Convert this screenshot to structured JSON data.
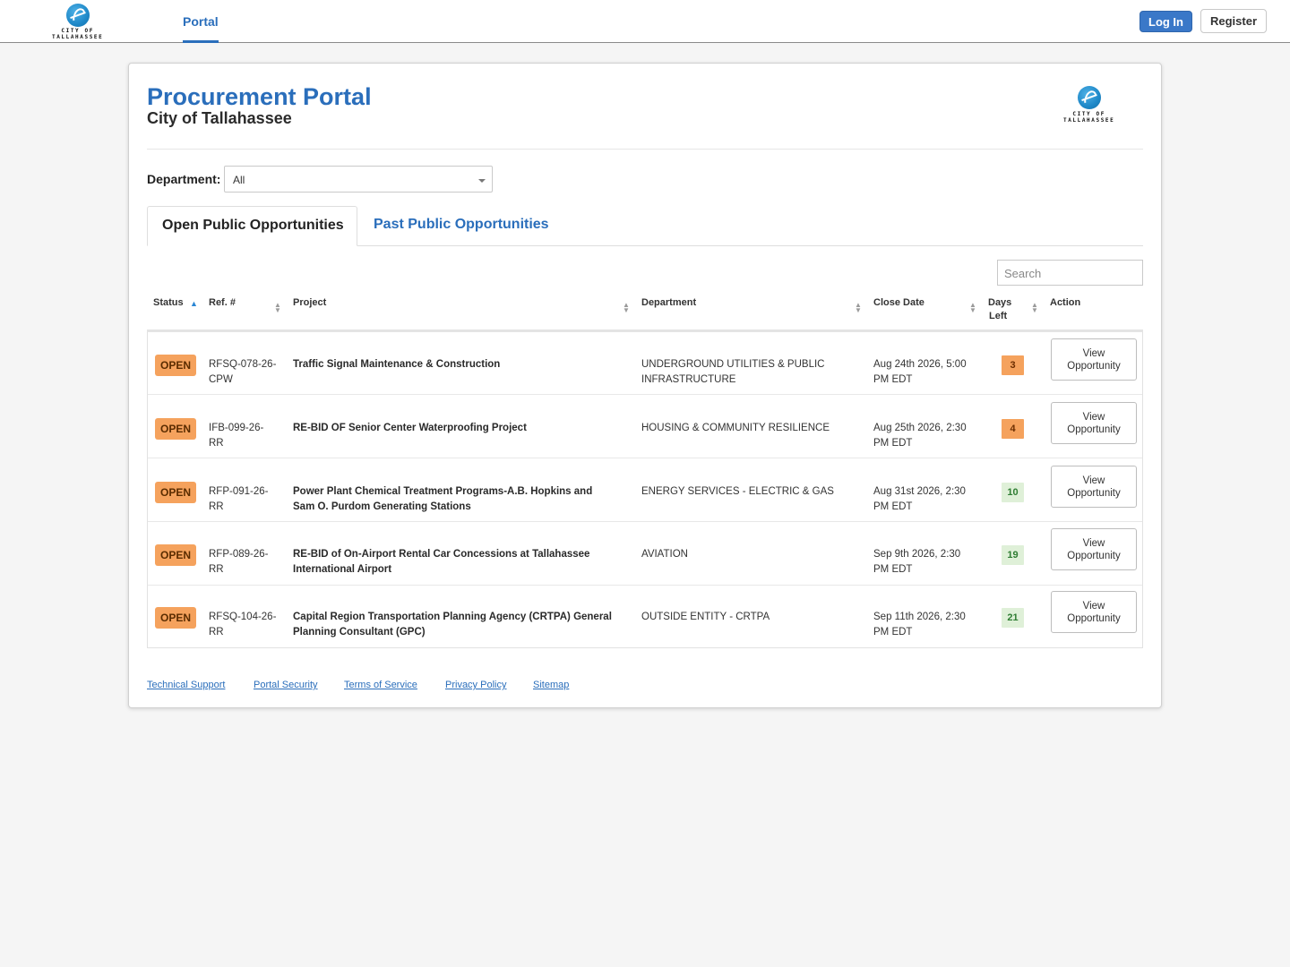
{
  "header": {
    "logo_line1": "CITY OF",
    "logo_line2": "TALLAHASSEE",
    "nav_portal": "Portal",
    "login_label": "Log In",
    "register_label": "Register"
  },
  "page": {
    "title": "Procurement Portal",
    "subtitle": "City of Tallahassee",
    "department_label": "Department:",
    "department_value": "All",
    "tabs": [
      {
        "label": "Open Public Opportunities",
        "active": true
      },
      {
        "label": "Past Public Opportunities",
        "active": false
      }
    ],
    "search_placeholder": "Search"
  },
  "table": {
    "columns": [
      "Status",
      "Ref. #",
      "Project",
      "Department",
      "Close Date",
      "Days Left",
      "Action"
    ],
    "days_left_lines": [
      "Days",
      "Left"
    ],
    "rows": [
      {
        "status": "OPEN",
        "ref": [
          "RFSQ-078-26-",
          "CPW"
        ],
        "project": [
          "Traffic Signal Maintenance & Construction",
          ""
        ],
        "department": [
          "UNDERGROUND UTILITIES & PUBLIC",
          "INFRASTRUCTURE"
        ],
        "close_date": [
          "Aug 24th 2026, 5:00",
          "PM EDT"
        ],
        "days_left": "3",
        "days_status": "warn",
        "action": [
          "View",
          "Opportunity"
        ]
      },
      {
        "status": "OPEN",
        "ref": [
          "IFB-099-26-",
          "RR"
        ],
        "project": [
          "RE-BID OF Senior Center Waterproofing Project",
          ""
        ],
        "department": [
          "HOUSING & COMMUNITY RESILIENCE",
          ""
        ],
        "close_date": [
          "Aug 25th 2026, 2:30",
          "PM EDT"
        ],
        "days_left": "4",
        "days_status": "warn",
        "action": [
          "View",
          "Opportunity"
        ]
      },
      {
        "status": "OPEN",
        "ref": [
          "RFP-091-26-",
          "RR"
        ],
        "project": [
          "Power Plant Chemical Treatment Programs-A.B. Hopkins and",
          "Sam O. Purdom Generating Stations"
        ],
        "department": [
          "ENERGY SERVICES - ELECTRIC & GAS",
          ""
        ],
        "close_date": [
          "Aug 31st 2026, 2:30",
          "PM EDT"
        ],
        "days_left": "10",
        "days_status": "ok",
        "action": [
          "View",
          "Opportunity"
        ]
      },
      {
        "status": "OPEN",
        "ref": [
          "RFP-089-26-",
          "RR"
        ],
        "project": [
          "RE-BID of On-Airport Rental Car Concessions at Tallahassee",
          "International Airport"
        ],
        "department": [
          "AVIATION",
          ""
        ],
        "close_date": [
          "Sep 9th 2026, 2:30",
          "PM EDT"
        ],
        "days_left": "19",
        "days_status": "ok",
        "action": [
          "View",
          "Opportunity"
        ]
      },
      {
        "status": "OPEN",
        "ref": [
          "RFSQ-104-26-",
          "RR"
        ],
        "project": [
          "Capital Region Transportation Planning Agency (CRTPA) General",
          "Planning Consultant (GPC)"
        ],
        "department": [
          "OUTSIDE ENTITY - CRTPA",
          ""
        ],
        "close_date": [
          "Sep 11th 2026, 2:30",
          "PM EDT"
        ],
        "days_left": "21",
        "days_status": "ok",
        "action": [
          "View",
          "Opportunity"
        ]
      }
    ]
  },
  "footer": {
    "links": [
      "Technical Support",
      "Portal Security",
      "Terms of Service",
      "Privacy Policy",
      "Sitemap"
    ]
  },
  "colors": {
    "brand_blue": "#2a6ebb",
    "open_badge": "#f5a25d",
    "days_warn": "#f5a25d",
    "days_ok": "#dff0d8"
  }
}
